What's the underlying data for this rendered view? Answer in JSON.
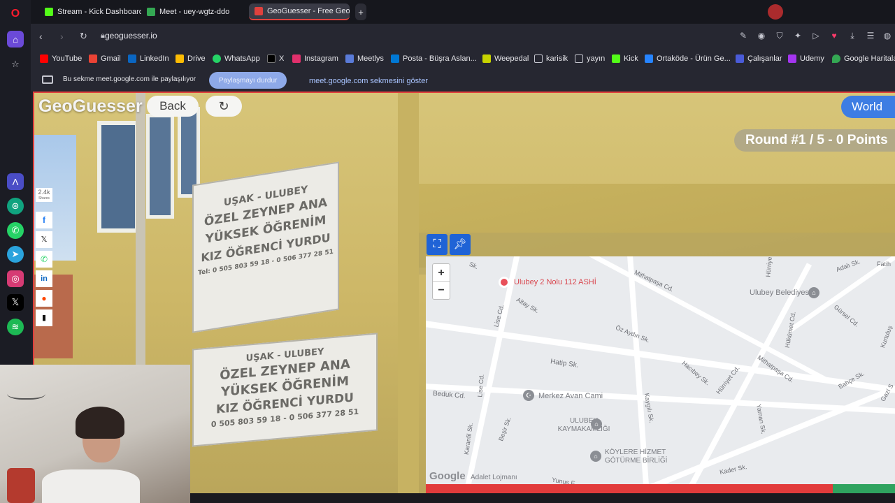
{
  "browser": {
    "tabs": [
      {
        "label": "Stream - Kick Dashboard",
        "active": false,
        "icon": "kick-icon"
      },
      {
        "label": "Meet - uey-wgtz-ddo",
        "active": false,
        "icon": "meet-icon"
      },
      {
        "label": "GeoGuesser - Free GeoG...",
        "active": true,
        "icon": "geoguesser-icon"
      }
    ],
    "url": "geoguesser.io",
    "bookmarks": [
      {
        "label": "YouTube",
        "icon": "youtube-icon",
        "color": "#ff0000"
      },
      {
        "label": "Gmail",
        "icon": "gmail-icon",
        "color": "#ea4335"
      },
      {
        "label": "LinkedIn",
        "icon": "linkedin-icon",
        "color": "#0a66c2"
      },
      {
        "label": "Drive",
        "icon": "drive-icon",
        "color": "#fbbc04"
      },
      {
        "label": "WhatsApp",
        "icon": "whatsapp-icon",
        "color": "#25d366"
      },
      {
        "label": "X",
        "icon": "x-icon",
        "color": "#ffffff"
      },
      {
        "label": "Instagram",
        "icon": "instagram-icon",
        "color": "#e1306c"
      },
      {
        "label": "Meetlys",
        "icon": "meetlys-icon",
        "color": "#5a7bd8"
      },
      {
        "label": "Posta - Büşra Aslan...",
        "icon": "outlook-icon",
        "color": "#0078d4"
      },
      {
        "label": "Weepedal",
        "icon": "weepedal-icon",
        "color": "#c8d400"
      },
      {
        "label": "karisik",
        "icon": "folder-icon",
        "color": "#c5c6cf"
      },
      {
        "label": "yayın",
        "icon": "folder-icon",
        "color": "#c5c6cf"
      },
      {
        "label": "Kick",
        "icon": "kick-icon",
        "color": "#53fc18"
      },
      {
        "label": "Ortaköde - Ürün Ge...",
        "icon": "trello-icon",
        "color": "#2684ff"
      },
      {
        "label": "Çalışanlar",
        "icon": "calisanlar-icon",
        "color": "#4a5bd8"
      },
      {
        "label": "Udemy",
        "icon": "udemy-icon",
        "color": "#a435f0"
      },
      {
        "label": "Google Haritalar",
        "icon": "maps-icon",
        "color": "#34a853"
      }
    ],
    "share_bar": {
      "message": "Bu sekme meet.google.com ile paylaşılıyor",
      "stop_label": "Paylaşmayı durdur",
      "show_label": "meet.google.com sekmesini göster"
    }
  },
  "geoguesser": {
    "logo": "GeoGuesser",
    "back_label": "Back",
    "world_label": "World",
    "round_text": "Round #1 / 5 - 0 Points"
  },
  "social": {
    "share_count": "2.4k",
    "share_caption": "Shares"
  },
  "street_view": {
    "sign_top": [
      "UŞAK - ULUBEY",
      "ÖZEL ZEYNEP ANA",
      "YÜKSEK ÖĞRENİM",
      "KIZ ÖĞRENCİ YURDU",
      "Tel: 0 505 803 59 18 - 0 506 377 28 51"
    ],
    "sign_bottom": [
      "UŞAK - ULUBEY",
      "ÖZEL ZEYNEP ANA",
      "YÜKSEK ÖĞRENİM",
      "KIZ ÖĞRENCİ YURDU",
      "0 505 803 59 18 - 0 506 377 28 51"
    ]
  },
  "map": {
    "zoom_in": "+",
    "zoom_out": "−",
    "pin_label": "Ulubey 2 Nolu 112 ASHİ",
    "pois": [
      "Ulubey Belediyesi",
      "Merkez Avan Cami",
      "ULUBEY KAYMAKAMLIĞI",
      "KÖYLERE HİZMET GÖTÜRME BİRLİĞİ",
      "Adalet Lojmanı"
    ],
    "streets": [
      "Mithatpaşa Cd.",
      "Altay Sk.",
      "Lise Cd.",
      "Öz Aydın Sk.",
      "Hatip Sk.",
      "Beduk Cd.",
      "Karanfil Sk.",
      "Beşir Sk.",
      "Kaygılı Sk.",
      "Hacıbey Sk.",
      "Hürriyet Cd.",
      "Hükümet Cd.",
      "Mithatpaşa Cd.",
      "Yaman Sk.",
      "Bahçe Sk.",
      "Gürsel Cd.",
      "Adalı Sk.",
      "Kader Sk.",
      "Yunus E...",
      "Lise Cd.",
      "Hürriye",
      "Kurtuluş",
      "Gazi S",
      "Fatih",
      "Sk."
    ],
    "google_label": "Google"
  },
  "colors": {
    "accent_red": "#e0413d",
    "world_blue": "#3d7de3"
  }
}
